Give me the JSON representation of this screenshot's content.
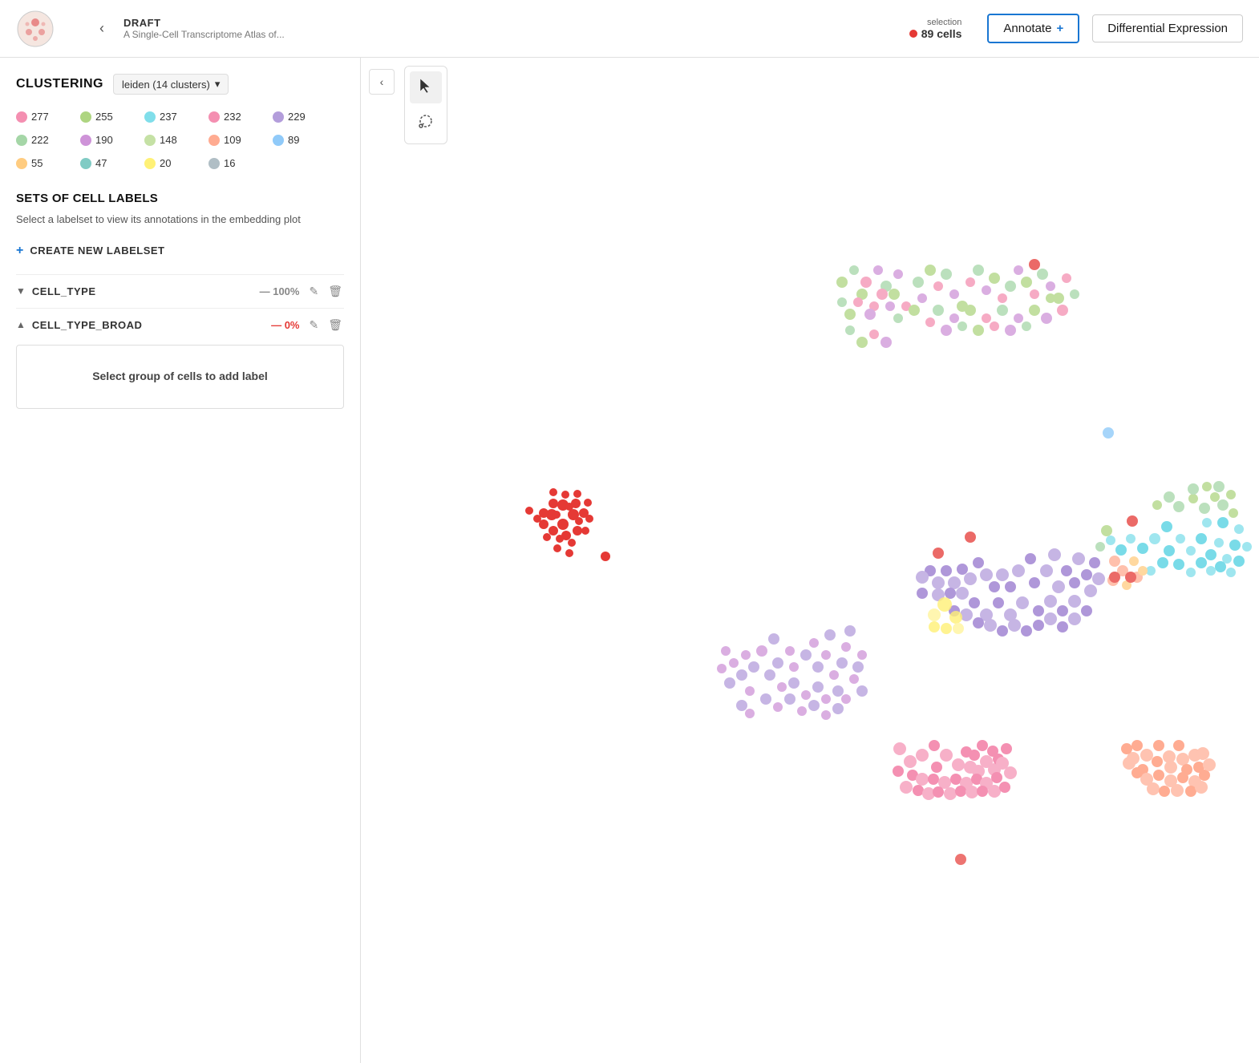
{
  "header": {
    "draft_label": "DRAFT",
    "subtitle": "A Single-Cell Transcriptome Atlas of...",
    "selection_label": "selection",
    "selection_count": "89 cells",
    "annotate_label": "Annotate",
    "annotate_plus": "+",
    "diff_expr_label": "Differential Expression",
    "back_arrow": "‹"
  },
  "sidebar": {
    "clustering_title": "CLUSTERING",
    "clustering_dropdown": "leiden (14 clusters)",
    "clusters": [
      {
        "id": "0",
        "count": "277",
        "color": "#f48fb1"
      },
      {
        "id": "1",
        "count": "255",
        "color": "#aed581"
      },
      {
        "id": "2",
        "count": "237",
        "color": "#80deea"
      },
      {
        "id": "3",
        "count": "232",
        "color": "#f48fb1"
      },
      {
        "id": "4",
        "count": "229",
        "color": "#b39ddb"
      },
      {
        "id": "5",
        "count": "222",
        "color": "#a5d6a7"
      },
      {
        "id": "6",
        "count": "190",
        "color": "#ce93d8"
      },
      {
        "id": "7",
        "count": "148",
        "color": "#c5e1a5"
      },
      {
        "id": "8",
        "count": "109",
        "color": "#ffab91"
      },
      {
        "id": "9",
        "count": "89",
        "color": "#90caf9"
      },
      {
        "id": "10",
        "count": "55",
        "color": "#ffcc80"
      },
      {
        "id": "11",
        "count": "47",
        "color": "#80cbc4"
      },
      {
        "id": "12",
        "count": "20",
        "color": "#fff176"
      },
      {
        "id": "13",
        "count": "16",
        "color": "#b0bec5"
      }
    ],
    "sets_title": "SETS OF CELL LABELS",
    "sets_desc": "Select a labelset to view its annotations in the embedding plot",
    "create_label": "CREATE NEW LABELSET",
    "labelsets": [
      {
        "name": "CELL_TYPE",
        "pct": "— 100%",
        "pct_color": "gray",
        "chevron": "▼"
      },
      {
        "name": "CELL_TYPE_BROAD",
        "pct": "— 0%",
        "pct_color": "red",
        "chevron": "▲"
      }
    ],
    "select_group_text": "Select group of cells to add label"
  },
  "tools": {
    "collapse_icon": "‹",
    "cursor_icon": "↖",
    "lasso_icon": "⊹"
  }
}
